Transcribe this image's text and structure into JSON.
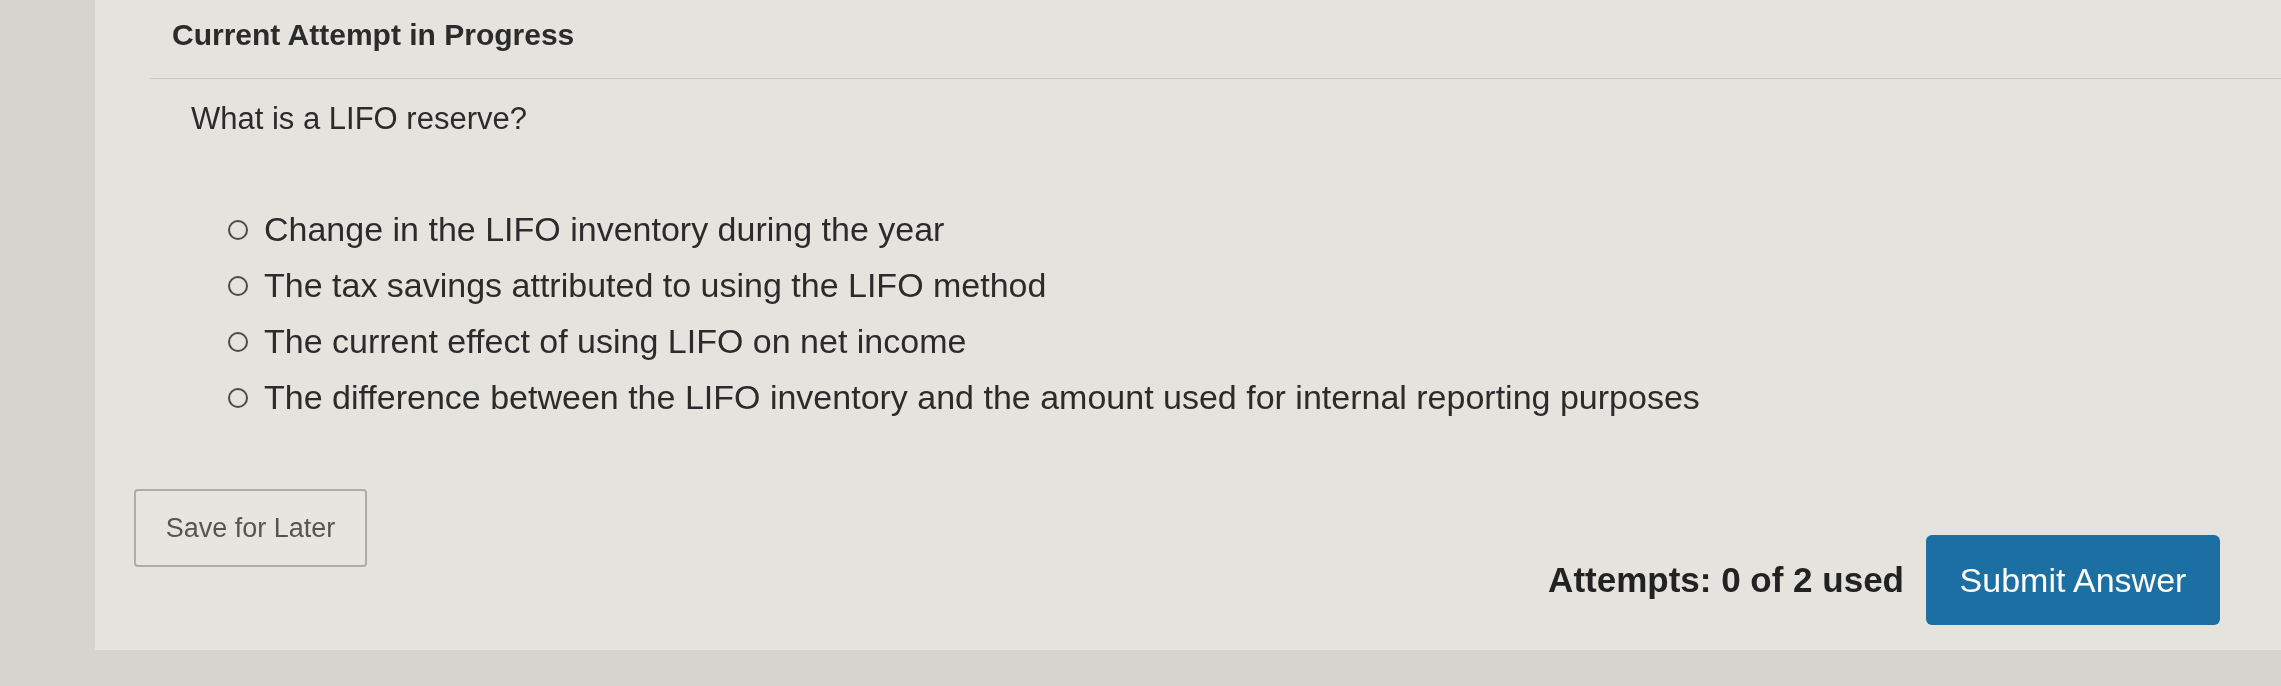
{
  "header": {
    "title": "Current Attempt in Progress"
  },
  "question": {
    "prompt": "What is a LIFO reserve?",
    "options": [
      {
        "label": "Change in the LIFO inventory during the year",
        "selected": false
      },
      {
        "label": "The tax savings attributed to using the LIFO method",
        "selected": false
      },
      {
        "label": "The current effect of using LIFO on net income",
        "selected": false
      },
      {
        "label": "The difference between the LIFO inventory and the amount used for internal reporting purposes",
        "selected": false
      }
    ]
  },
  "footer": {
    "save_button": "Save for Later",
    "attempts": "Attempts: 0 of 2 used",
    "submit_button": "Submit Answer"
  }
}
